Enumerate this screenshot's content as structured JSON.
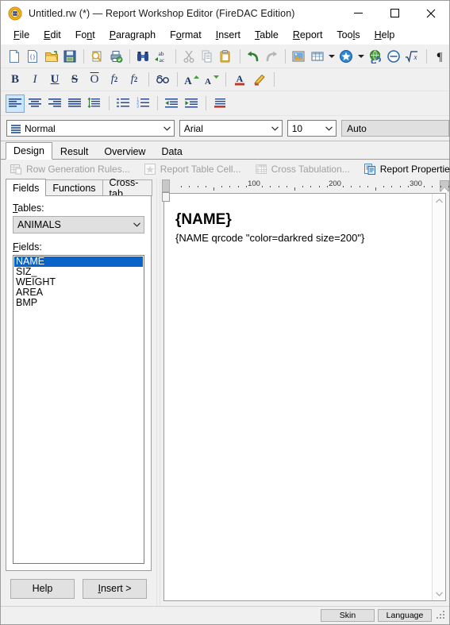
{
  "window": {
    "title": "Untitled.rw (*) — Report Workshop Editor (FireDAC Edition)",
    "icon": "report-workshop-icon",
    "minimize_label": "─",
    "maximize_label": "☐",
    "close_label": "✕"
  },
  "menubar": {
    "items": [
      {
        "label": "File"
      },
      {
        "label": "Edit"
      },
      {
        "label": "Font"
      },
      {
        "label": "Paragraph"
      },
      {
        "label": "Format"
      },
      {
        "label": "Insert"
      },
      {
        "label": "Table"
      },
      {
        "label": "Report"
      },
      {
        "label": "Tools"
      },
      {
        "label": "Help"
      }
    ]
  },
  "toolbar_main": {
    "items": [
      {
        "name": "new-document-icon",
        "tip": "New"
      },
      {
        "name": "new-template-icon",
        "tip": "New from template"
      },
      {
        "name": "open-folder-icon",
        "tip": "Open"
      },
      {
        "name": "save-floppy-icon",
        "tip": "Save"
      },
      {
        "name": "separator"
      },
      {
        "name": "print-preview-icon",
        "tip": "Print preview"
      },
      {
        "name": "print-icon",
        "tip": "Print"
      },
      {
        "name": "separator"
      },
      {
        "name": "find-binoculars-icon",
        "tip": "Find"
      },
      {
        "name": "replace-abac-icon",
        "tip": "Replace"
      },
      {
        "name": "separator"
      },
      {
        "name": "cut-scissors-icon",
        "tip": "Cut"
      },
      {
        "name": "copy-icon",
        "tip": "Copy"
      },
      {
        "name": "paste-clipboard-icon",
        "tip": "Paste"
      },
      {
        "name": "separator"
      },
      {
        "name": "undo-arrow-icon",
        "tip": "Undo"
      },
      {
        "name": "redo-arrow-icon",
        "tip": "Redo"
      },
      {
        "name": "separator"
      },
      {
        "name": "insert-image-icon",
        "tip": "Insert image"
      },
      {
        "name": "insert-table-icon",
        "tip": "Insert table"
      },
      {
        "name": "insert-table-dropdown-icon",
        "tip": "Table options"
      },
      {
        "name": "insert-star-field-icon",
        "tip": "Insert field"
      },
      {
        "name": "insert-field-dropdown-icon",
        "tip": "Field options"
      },
      {
        "name": "insert-hyperlink-icon",
        "tip": "Insert hyperlink"
      },
      {
        "name": "insert-symbol-icon",
        "tip": "Insert symbol"
      },
      {
        "name": "insert-formula-icon",
        "tip": "Insert formula"
      },
      {
        "name": "separator"
      },
      {
        "name": "show-paragraph-marks-icon",
        "tip": "Show formatting marks"
      }
    ]
  },
  "toolbar_font": {
    "items": [
      {
        "name": "bold-icon",
        "glyph": "B"
      },
      {
        "name": "italic-icon",
        "glyph": "I"
      },
      {
        "name": "underline-icon",
        "glyph": "U"
      },
      {
        "name": "strikethrough-icon",
        "glyph": "S"
      },
      {
        "name": "overline-icon",
        "glyph": "O"
      },
      {
        "name": "subscript-icon",
        "glyph": "f₂"
      },
      {
        "name": "superscript-icon",
        "glyph": "f²"
      },
      {
        "name": "separator"
      },
      {
        "name": "small-caps-icon",
        "glyph": "ɓɓ"
      },
      {
        "name": "separator"
      },
      {
        "name": "grow-font-icon",
        "glyph": "A"
      },
      {
        "name": "shrink-font-icon",
        "glyph": "A"
      },
      {
        "name": "separator"
      },
      {
        "name": "font-color-icon",
        "glyph": "A"
      },
      {
        "name": "highlight-color-icon",
        "glyph": "✎"
      }
    ]
  },
  "toolbar_paragraph": {
    "items": [
      {
        "name": "align-left-icon",
        "active": true
      },
      {
        "name": "align-center-icon",
        "active": false
      },
      {
        "name": "align-right-icon",
        "active": false
      },
      {
        "name": "align-justify-icon",
        "active": false
      },
      {
        "name": "line-spacing-icon",
        "active": false
      },
      {
        "name": "separator"
      },
      {
        "name": "bullet-list-icon",
        "active": false
      },
      {
        "name": "numbered-list-icon",
        "active": false
      },
      {
        "name": "separator"
      },
      {
        "name": "decrease-indent-icon",
        "active": false
      },
      {
        "name": "increase-indent-icon",
        "active": false
      },
      {
        "name": "separator"
      },
      {
        "name": "paragraph-border-icon",
        "active": false
      }
    ]
  },
  "format_row": {
    "style": {
      "label": "Normal",
      "icon": "paragraph-style-icon"
    },
    "font": {
      "label": "Arial"
    },
    "size": {
      "label": "10"
    },
    "color": {
      "label": "Auto"
    }
  },
  "main_tabs": {
    "items": [
      {
        "label": "Design",
        "selected": true
      },
      {
        "label": "Result",
        "selected": false
      },
      {
        "label": "Overview",
        "selected": false
      },
      {
        "label": "Data",
        "selected": false
      }
    ]
  },
  "command_strip": {
    "items": [
      {
        "label": "Row Generation Rules...",
        "icon": "row-rules-icon",
        "disabled": true,
        "accel": "R"
      },
      {
        "label": "Report Table Cell...",
        "icon": "table-cell-star-icon",
        "disabled": true,
        "accel": "C"
      },
      {
        "label": "Cross Tabulation...",
        "icon": "cross-tab-icon",
        "disabled": true,
        "accel": "T"
      },
      {
        "label": "Report Properties...",
        "icon": "report-properties-icon",
        "disabled": false,
        "accel": "P"
      }
    ]
  },
  "left_panel": {
    "tabs": [
      {
        "label": "Fields",
        "selected": true
      },
      {
        "label": "Functions",
        "selected": false
      },
      {
        "label": "Cross-tab",
        "selected": false
      }
    ],
    "tables_label": "Tables:",
    "tables_value": "ANIMALS",
    "fields_label": "Fields:",
    "fields": [
      {
        "label": "NAME",
        "selected": true
      },
      {
        "label": "SIZ_",
        "selected": false
      },
      {
        "label": "WEIGHT",
        "selected": false
      },
      {
        "label": "AREA",
        "selected": false
      },
      {
        "label": "BMP",
        "selected": false
      }
    ],
    "help_button": "Help",
    "insert_button": "Insert >"
  },
  "ruler": {
    "unit_marks": [
      "100",
      "200",
      "300"
    ],
    "positions": [
      100,
      200,
      300
    ]
  },
  "document": {
    "heading": "{NAME}",
    "body": "{NAME qrcode \"color=darkred size=200\"}"
  },
  "statusbar": {
    "skin_button": "Skin",
    "language_button": "Language"
  },
  "colors": {
    "selection_blue": "#0a64c8",
    "titlebar_bg": "#ffffff",
    "chrome_bg": "#f0f0f0",
    "accent_orange": "#f0a818",
    "border_gray": "#9c9c9c"
  }
}
